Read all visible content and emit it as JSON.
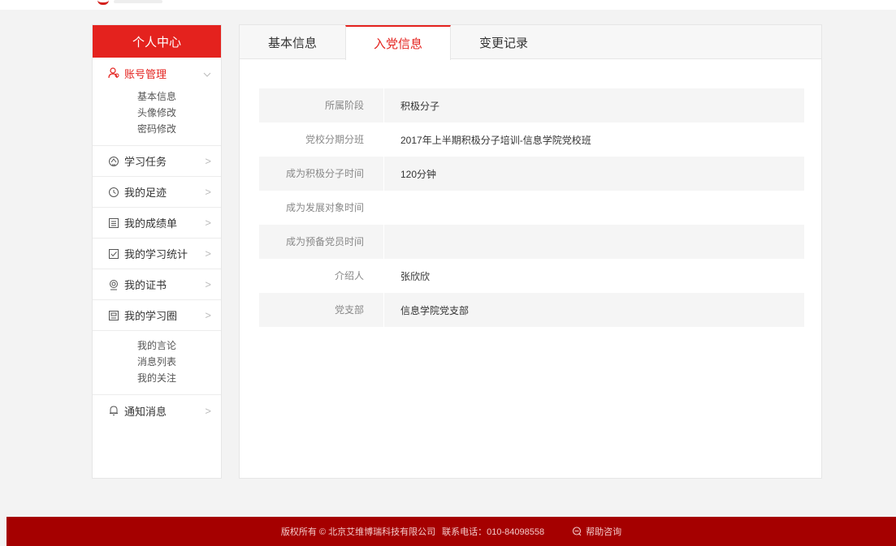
{
  "sidebar": {
    "title": "个人中心",
    "account": {
      "label": "账号管理",
      "icon": "user-icon",
      "sub_items": [
        "基本信息",
        "头像修改",
        "密码修改"
      ]
    },
    "items": [
      {
        "label": "学习任务",
        "icon": "task-icon"
      },
      {
        "label": "我的足迹",
        "icon": "history-icon"
      },
      {
        "label": "我的成绩单",
        "icon": "report-icon"
      },
      {
        "label": "我的学习统计",
        "icon": "checkbox-icon"
      },
      {
        "label": "我的证书",
        "icon": "certificate-icon"
      },
      {
        "label": "我的学习圈",
        "icon": "circle-icon"
      }
    ],
    "circle_sub_items": [
      "我的言论",
      "消息列表",
      "我的关注"
    ],
    "notice": {
      "label": "通知消息",
      "icon": "bell-icon"
    }
  },
  "tabs": [
    "基本信息",
    "入党信息",
    "变更记录"
  ],
  "active_tab": "入党信息",
  "info": [
    {
      "label": "所属阶段",
      "value": "积极分子"
    },
    {
      "label": "党校分期分班",
      "value": "2017年上半期积极分子培训-信息学院党校班"
    },
    {
      "label": "成为积极分子时间",
      "value": "120分钟"
    },
    {
      "label": "成为发展对象时间",
      "value": ""
    },
    {
      "label": "成为预备党员时间",
      "value": ""
    },
    {
      "label": "介绍人",
      "value": "张欣欣"
    },
    {
      "label": "党支部",
      "value": "信息学院党支部"
    }
  ],
  "footer": {
    "copyright": "版权所有 © 北京艾维博瑞科技有限公司",
    "phone": "联系电话：010-84098558",
    "help": "帮助咨询"
  },
  "colors": {
    "accent": "#e4221e",
    "footer": "#a50000"
  }
}
